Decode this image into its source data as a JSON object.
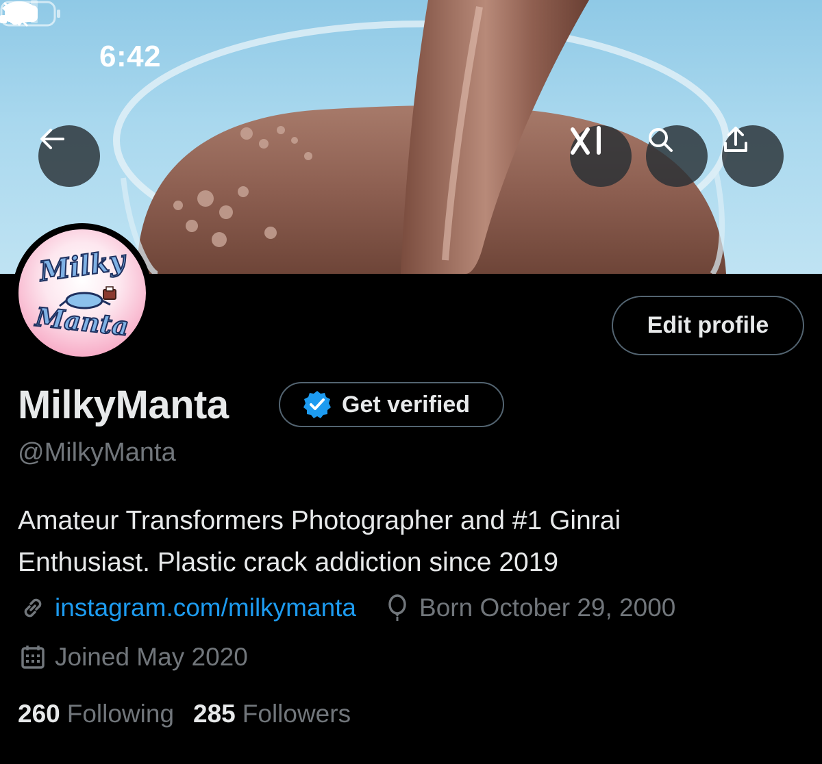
{
  "status_bar": {
    "time": "6:42"
  },
  "banner_buttons": {
    "back": "arrow-left-icon",
    "grok": "grok-icon",
    "search": "search-icon",
    "share": "share-icon"
  },
  "avatar": {
    "logo_line1": "Milky",
    "logo_line2": "Manta"
  },
  "profile": {
    "edit_label": "Edit profile",
    "display_name": "MilkyManta",
    "verify_label": "Get verified",
    "handle": "@MilkyManta",
    "bio_line1": "Amateur Transformers Photographer and #1 Ginrai",
    "bio_line2": "Enthusiast. Plastic crack addiction since 2019",
    "website": "instagram.com/milkymanta",
    "birthday": "Born October 29, 2000",
    "joined": "Joined May 2020"
  },
  "stats": {
    "following_count": "260",
    "following_label": "Following",
    "followers_count": "285",
    "followers_label": "Followers"
  },
  "colors": {
    "accent": "#1d9bf0",
    "muted": "#71767b",
    "text": "#e7e9ea",
    "background": "#000000"
  }
}
